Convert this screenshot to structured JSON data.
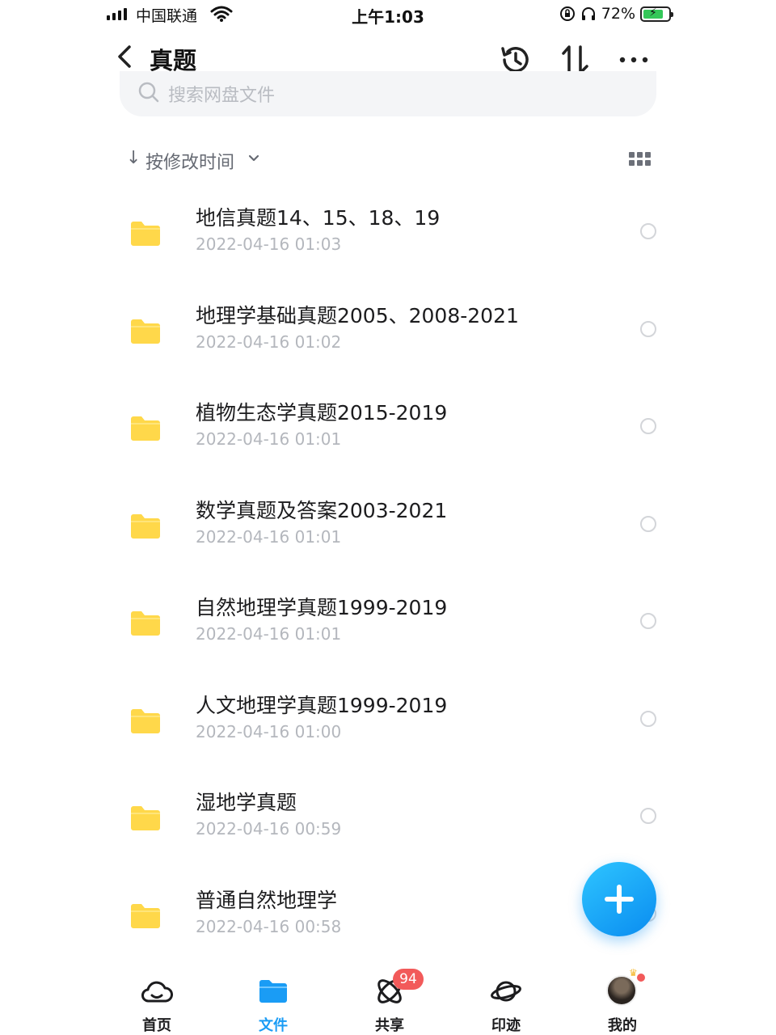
{
  "status_bar": {
    "carrier": "中国联通",
    "time": "上午1:03",
    "battery": "72%"
  },
  "header": {
    "title": "真题",
    "icons": [
      "back-chevron-icon",
      "history-icon",
      "sort-icon",
      "more-icon"
    ]
  },
  "search": {
    "placeholder": "搜索网盘文件"
  },
  "sort": {
    "label": "按修改时间"
  },
  "files": [
    {
      "name": "地信真题14、15、18、19",
      "date": "2022-04-16 01:03"
    },
    {
      "name": "地理学基础真题2005、2008-2021",
      "date": "2022-04-16 01:02"
    },
    {
      "name": "植物生态学真题2015-2019",
      "date": "2022-04-16 01:01"
    },
    {
      "name": "数学真题及答案2003-2021",
      "date": "2022-04-16 01:01"
    },
    {
      "name": "自然地理学真题1999-2019",
      "date": "2022-04-16 01:01"
    },
    {
      "name": "人文地理学真题1999-2019",
      "date": "2022-04-16 01:00"
    },
    {
      "name": "湿地学真题",
      "date": "2022-04-16 00:59"
    },
    {
      "name": "普通自然地理学",
      "date": "2022-04-16 00:58"
    }
  ],
  "tabs": [
    {
      "label": "首页",
      "icon": "cloud-home-icon"
    },
    {
      "label": "文件",
      "icon": "folder-icon",
      "active": true
    },
    {
      "label": "共享",
      "icon": "atom-share-icon",
      "badge": "94"
    },
    {
      "label": "印迹",
      "icon": "planet-icon"
    },
    {
      "label": "我的",
      "icon": "avatar"
    }
  ],
  "colors": {
    "accent": "#1a9cf5",
    "folder": "#ffd84a",
    "badge": "#f25a5a",
    "fab": "#0a8cf0"
  }
}
